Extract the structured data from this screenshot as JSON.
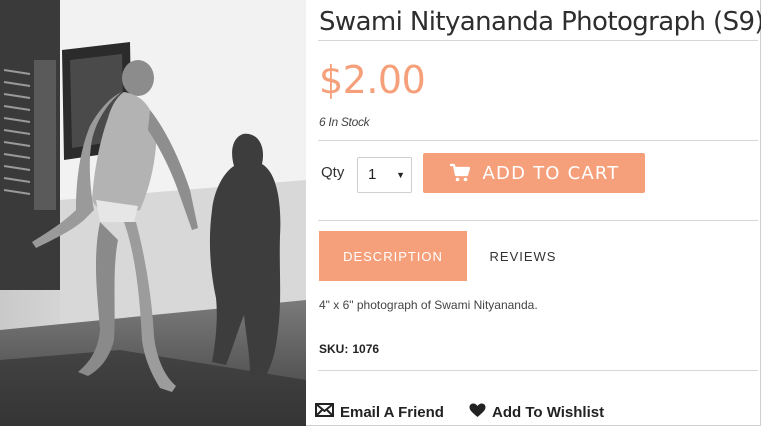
{
  "product": {
    "title": "Swami Nityananda Photograph (S9)",
    "price": "$2.00",
    "stock": "6 In Stock"
  },
  "purchase": {
    "qty_label": "Qty",
    "qty_value": "1",
    "add_to_cart_label": "ADD TO CART"
  },
  "tabs": {
    "description": "DESCRIPTION",
    "reviews": "REVIEWS"
  },
  "description": {
    "text": "4\" x 6\" photograph of Swami Nityananda.",
    "sku_label": "SKU:",
    "sku_value": "1076"
  },
  "actions": {
    "email_friend": "Email A Friend",
    "add_to_wishlist": "Add To Wishlist"
  },
  "icons": {
    "cart": "cart-icon",
    "email": "envelope-icon",
    "wishlist": "heart-icon",
    "select_arrow": "chevron-down-icon"
  },
  "colors": {
    "accent": "#f6a07b",
    "text": "#333333"
  }
}
